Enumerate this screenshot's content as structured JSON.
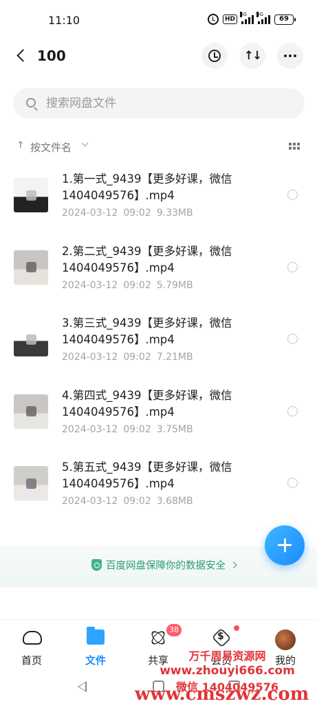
{
  "status_bar": {
    "time": "11:10",
    "network_badge": "HD",
    "signal1_tag": "4G",
    "signal2_tag": "4G",
    "battery": "69"
  },
  "header": {
    "title": "100"
  },
  "search": {
    "placeholder": "搜索网盘文件"
  },
  "sort": {
    "label": "按文件名"
  },
  "files": [
    {
      "name": "1.第一式_9439【更多好课，微信1404049576】.mp4",
      "date": "2024-03-12",
      "time": "09:02",
      "size": "9.33MB",
      "thumb_colors": [
        "#f3f3f3",
        "#222222",
        "#bbbbbb"
      ]
    },
    {
      "name": "2.第二式_9439【更多好课，微信1404049576】.mp4",
      "date": "2024-03-12",
      "time": "09:02",
      "size": "5.79MB",
      "thumb_colors": [
        "#c8c6c2",
        "#e6e2dc",
        "#6a6466"
      ]
    },
    {
      "name": "3.第三式_9439【更多好课，微信1404049576】.mp4",
      "date": "2024-03-12",
      "time": "09:02",
      "size": "7.21MB",
      "thumb_colors": [
        "#ffffff",
        "#3a3a3a",
        "#bcbcbc"
      ]
    },
    {
      "name": "4.第四式_9439【更多好课，微信1404049576】.mp4",
      "date": "2024-03-12",
      "time": "09:02",
      "size": "3.75MB",
      "thumb_colors": [
        "#c9c7c4",
        "#e8e6e3",
        "#6b6566"
      ]
    },
    {
      "name": "5.第五式_9439【更多好课，微信1404049576】.mp4",
      "date": "2024-03-12",
      "time": "09:02",
      "size": "3.68MB",
      "thumb_colors": [
        "#d0cecb",
        "#ebe8e5",
        "#77707a"
      ]
    }
  ],
  "banner": {
    "text": "百度网盘保障你的数据安全"
  },
  "nav": {
    "home": "首页",
    "files": "文件",
    "share": "共享",
    "share_badge": "38",
    "vip": "会员",
    "mine": "我的"
  },
  "watermark": {
    "line1": "万千周易资源网",
    "line2": "www.zhouyi666.com",
    "line3": "微信 1404049576",
    "big": "www.cmszwz.com"
  },
  "colors": {
    "accent": "#1a8cff",
    "safe_green": "#2d9a78",
    "badge_red": "#ff5a6e",
    "watermark_red": "#e0343a"
  }
}
